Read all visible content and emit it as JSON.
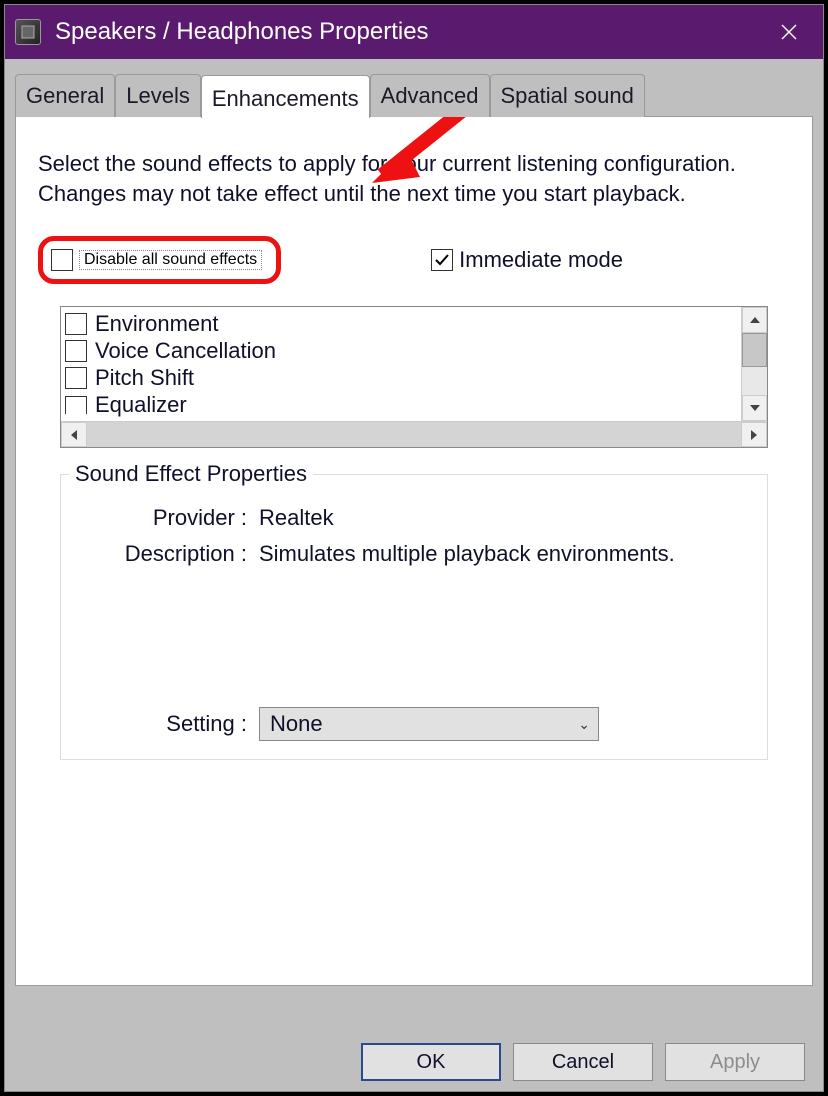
{
  "window": {
    "title": "Speakers / Headphones Properties"
  },
  "tabs": {
    "items": [
      "General",
      "Levels",
      "Enhancements",
      "Advanced",
      "Spatial sound"
    ],
    "active_index": 2
  },
  "panel": {
    "intro": "Select the sound effects to apply for your current listening configuration. Changes may not take effect until the next time you start playback.",
    "disable_all_label": "Disable all sound effects",
    "disable_all_checked": false,
    "immediate_mode_label": "Immediate mode",
    "immediate_mode_checked": true,
    "effects": [
      {
        "label": "Environment",
        "checked": false
      },
      {
        "label": "Voice Cancellation",
        "checked": false
      },
      {
        "label": "Pitch Shift",
        "checked": false
      },
      {
        "label": "Equalizer",
        "checked": false
      }
    ]
  },
  "properties": {
    "legend": "Sound Effect Properties",
    "provider_label": "Provider :",
    "provider_value": "Realtek",
    "description_label": "Description :",
    "description_value": "Simulates multiple playback environments.",
    "setting_label": "Setting :",
    "setting_value": "None"
  },
  "buttons": {
    "ok": "OK",
    "cancel": "Cancel",
    "apply": "Apply"
  },
  "annotations": {
    "arrow_target": "tab-enhancements",
    "highlight_target": "disable-all-sound-effects-checkbox"
  }
}
